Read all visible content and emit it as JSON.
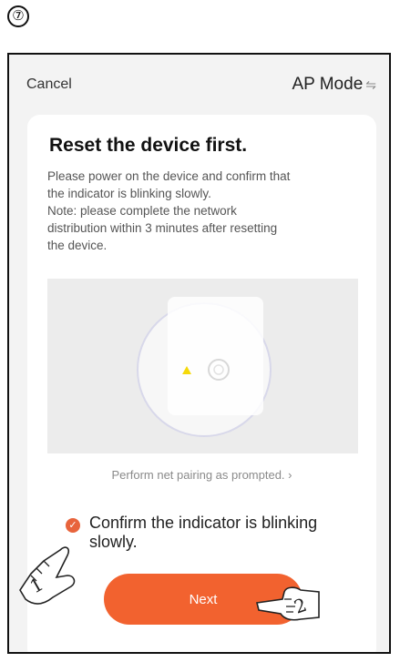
{
  "step": {
    "number": "⑦"
  },
  "header": {
    "cancel_label": "Cancel",
    "mode_label": "AP Mode",
    "mode_icon": "swap-arrows-icon"
  },
  "card": {
    "title": "Reset the device first.",
    "description": "Please power on the device and confirm that\nthe indicator is blinking slowly.\nNote: please complete the network\ndistribution within 3 minutes after resetting\nthe device.",
    "prompt_link": "Perform net pairing as prompted. ›",
    "confirm_label": "Confirm the indicator is blinking slowly.",
    "confirm_checked": true,
    "next_label": "Next"
  },
  "annotations": {
    "hand_1": "1",
    "hand_2": "2"
  },
  "colors": {
    "accent": "#f2622f",
    "check": "#e8643c",
    "indicator": "#f5d90a"
  }
}
